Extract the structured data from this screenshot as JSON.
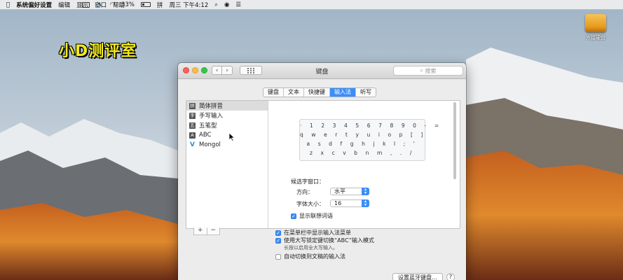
{
  "menubar": {
    "apple": "",
    "items": [
      "系统偏好设置",
      "编辑",
      "显示",
      "窗口",
      "帮助"
    ],
    "status": {
      "battery": "33%",
      "clock": "周三 下午4:12",
      "battery_level": 0.33
    }
  },
  "desktop": {
    "watermark": "小D测评室",
    "drive_label": "外接硬盘"
  },
  "window": {
    "title": "键盘",
    "search_placeholder": "搜索",
    "back": "‹",
    "forward": "›",
    "tabs": [
      {
        "label": "键盘",
        "active": false
      },
      {
        "label": "文本",
        "active": false
      },
      {
        "label": "快捷键",
        "active": false
      },
      {
        "label": "输入法",
        "active": true
      },
      {
        "label": "听写",
        "active": false
      }
    ],
    "input_sources": [
      {
        "icon": "拼",
        "label": "简体拼音",
        "selected": true
      },
      {
        "icon": "字",
        "label": "手写输入",
        "selected": false
      },
      {
        "icon": "五",
        "label": "五笔型",
        "selected": false
      },
      {
        "icon": "A",
        "label": "ABC",
        "selected": false
      },
      {
        "icon": "V",
        "label": "Mongol",
        "selected": false
      }
    ],
    "keyboard_rows": [
      "· 1 2 3 4 5 6 7 8 9 0 - =",
      "q w e r t y u i o p [ ]",
      "a s d f g h j k l ; '",
      "z x c v b n m , . /"
    ],
    "candidate_window_label": "候选字窗口：",
    "direction_label": "方向：",
    "direction_value": "水平",
    "font_size_label": "字体大小：",
    "font_size_value": "16",
    "show_predictive": {
      "label": "显示联想词语",
      "checked": true
    },
    "add_button": "+",
    "remove_button": "−",
    "show_in_menu": {
      "label": "在菜单栏中显示输入法菜单",
      "checked": true
    },
    "caps_lock_switch": {
      "label": "使用大写锁定键切换“ABC”输入模式",
      "checked": true
    },
    "caps_lock_hint": "长按以启用全大写输入。",
    "auto_switch": {
      "label": "自动切换到文稿的输入法",
      "checked": false
    },
    "bluetooth_button": "设置蓝牙键盘...",
    "help_button": "?"
  }
}
